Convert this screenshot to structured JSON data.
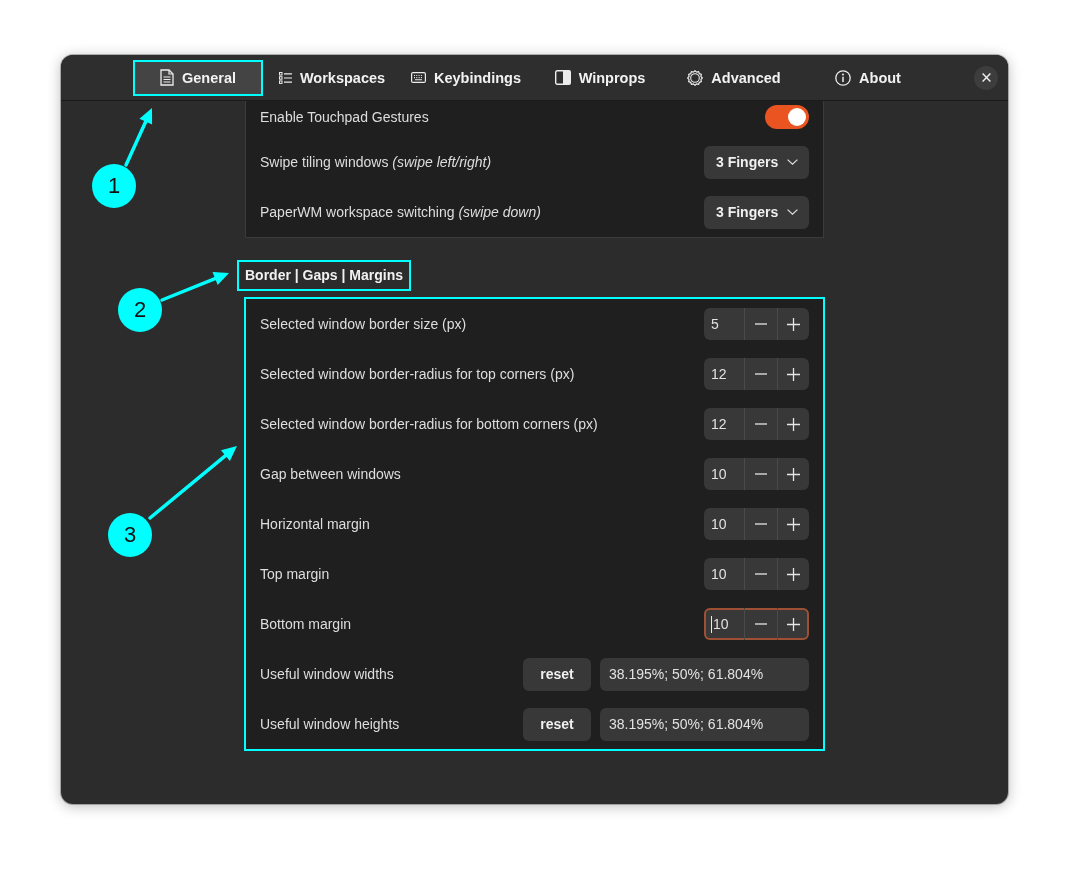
{
  "tabs": [
    {
      "label": "General",
      "selected": true,
      "highlighted": true
    },
    {
      "label": "Workspaces",
      "selected": false,
      "highlighted": false
    },
    {
      "label": "Keybindings",
      "selected": false,
      "highlighted": false
    },
    {
      "label": "Winprops",
      "selected": false,
      "highlighted": false
    },
    {
      "label": "Advanced",
      "selected": false,
      "highlighted": false
    },
    {
      "label": "About",
      "selected": false,
      "highlighted": false
    }
  ],
  "gestures": {
    "highlighted": false,
    "rows": [
      {
        "kind": "toggle",
        "label": "Enable Touchpad Gestures",
        "on": true
      },
      {
        "kind": "dropdown",
        "label": "Swipe tiling windows *(swipe left/right)*",
        "value": "3 Fingers"
      },
      {
        "kind": "dropdown",
        "label": "PaperWM workspace switching *(swipe down)*",
        "value": "3 Fingers"
      }
    ]
  },
  "border_gaps_margins": {
    "title": "Border | Gaps | Margins",
    "title_highlighted": true,
    "highlighted": true,
    "rows": [
      {
        "kind": "spin",
        "label": "Selected window border size (px)",
        "value": "5",
        "focused": false
      },
      {
        "kind": "spin",
        "label": "Selected window border-radius for top corners (px)",
        "value": "12",
        "focused": false
      },
      {
        "kind": "spin",
        "label": "Selected window border-radius for bottom corners (px)",
        "value": "12",
        "focused": false
      },
      {
        "kind": "spin",
        "label": "Gap between windows",
        "value": "10",
        "focused": false
      },
      {
        "kind": "spin",
        "label": "Horizontal margin",
        "value": "10",
        "focused": false
      },
      {
        "kind": "spin",
        "label": "Top margin",
        "value": "10",
        "focused": false
      },
      {
        "kind": "spin",
        "label": "Bottom margin",
        "value": "10",
        "focused": true
      },
      {
        "kind": "list",
        "label": "Useful window widths",
        "button": "reset",
        "value": "38.195%; 50%; 61.804%"
      },
      {
        "kind": "list",
        "label": "Useful window heights",
        "button": "reset",
        "value": "38.195%; 50%; 61.804%"
      }
    ]
  },
  "callouts": [
    {
      "number": "1"
    },
    {
      "number": "2"
    },
    {
      "number": "3"
    }
  ]
}
